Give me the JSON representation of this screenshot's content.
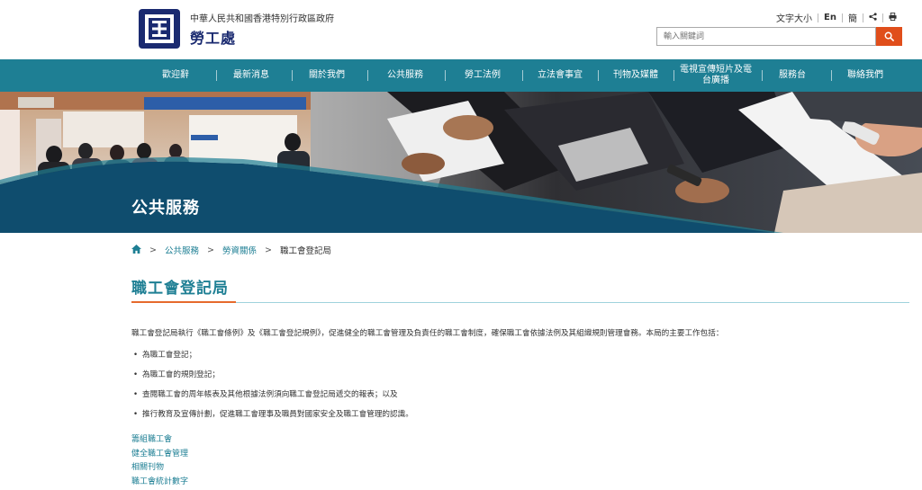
{
  "header": {
    "gov_name": "中華人民共和國香港特別行政區政府",
    "dept_name": "勞工處",
    "toolbar": {
      "font_size": "文字大小",
      "english": "En",
      "simplified": "簡"
    },
    "search": {
      "placeholder": "輸入關鍵詞"
    }
  },
  "nav": {
    "items": [
      "歡迎辭",
      "最新消息",
      "關於我們",
      "公共服務",
      "勞工法例",
      "立法會事宜",
      "刊物及媒體",
      "電視宣傳短片及電台廣播",
      "服務台",
      "聯絡我們"
    ]
  },
  "banner": {
    "title": "公共服務"
  },
  "breadcrumb": {
    "items": [
      "公共服務",
      "勞資關係"
    ],
    "current": "職工會登記局",
    "separator": ">"
  },
  "page": {
    "title": "職工會登記局",
    "intro": "職工會登記局執行《職工會條例》及《職工會登記規例》，促進健全的職工會管理及負責任的職工會制度，確保職工會依據法例及其組織規則管理會務。本局的主要工作包括：",
    "duties": [
      "為職工會登記；",
      "為職工會的規則登記；",
      "查閱職工會的周年帳表及其他根據法例須向職工會登記局遞交的報表；以及",
      "推行教育及宣傳計劃，促進職工會理事及職員對國家安全及職工會管理的認識。"
    ],
    "links": [
      "籌組職工會",
      "健全職工會管理",
      "相關刊物",
      "職工會統計數字"
    ]
  },
  "colors": {
    "nav_bg": "#1e7f94",
    "accent_orange": "#e04e1b",
    "banner_navy": "#0f4d6e",
    "logo_navy": "#1a2a70"
  }
}
